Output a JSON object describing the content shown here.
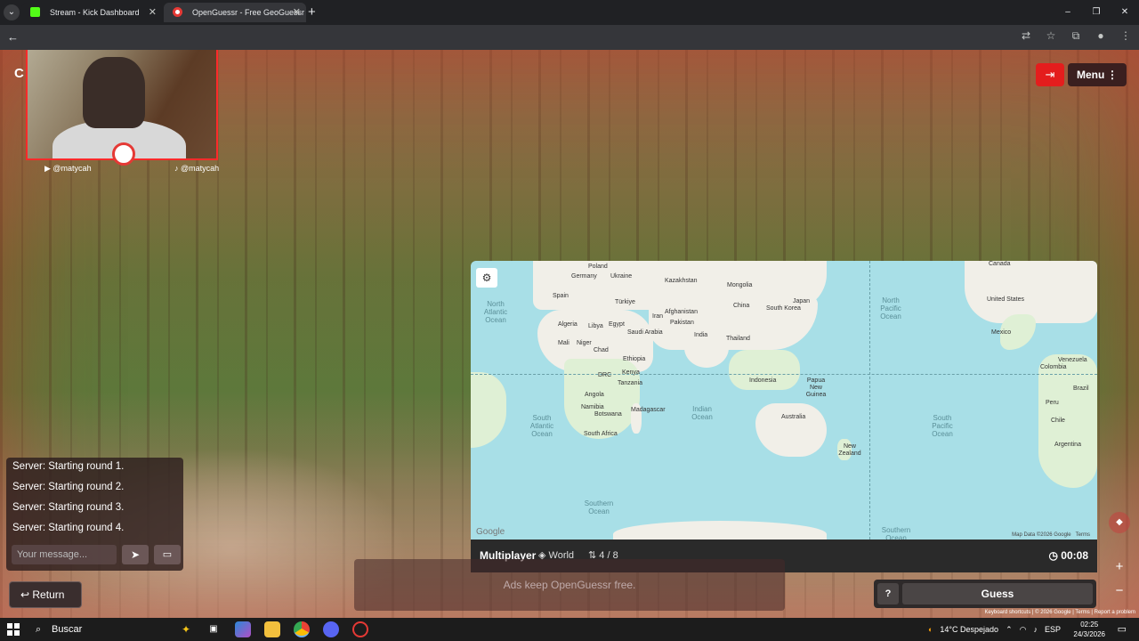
{
  "browser": {
    "tabs": [
      {
        "label": "Stream - Kick Dashboard"
      },
      {
        "label": "OpenGuessr - Free GeoGuessr"
      }
    ],
    "new_tab": "+",
    "window": {
      "minimize": "–",
      "restore": "❐",
      "close": "✕"
    }
  },
  "page": {
    "corner_letter": "C",
    "webcam": {
      "handle_left": "@matycah",
      "handle_right": "@matycah"
    },
    "menu_label": "Menu",
    "map": {
      "countries": {
        "poland": "Poland",
        "germany": "Germany",
        "ukraine": "Ukraine",
        "spain": "Spain",
        "turkiye": "Türkiye",
        "kazakhstan": "Kazakhstan",
        "mongolia": "Mongolia",
        "afghanistan": "Afghanistan",
        "iran": "Iran",
        "pakistan": "Pakistan",
        "china": "China",
        "south_korea": "South Korea",
        "japan": "Japan",
        "algeria": "Algeria",
        "libya": "Libya",
        "egypt": "Egypt",
        "saudi_arabia": "Saudi Arabia",
        "india": "India",
        "thailand": "Thailand",
        "mali": "Mali",
        "niger": "Niger",
        "chad": "Chad",
        "ethiopia": "Ethiopia",
        "kenya": "Kenya",
        "drc": "DRC",
        "tanzania": "Tanzania",
        "angola": "Angola",
        "namibia": "Namibia",
        "botswana": "Botswana",
        "south_africa": "South Africa",
        "madagascar": "Madagascar",
        "indonesia": "Indonesia",
        "papua_new_guinea": "Papua New Guinea",
        "australia": "Australia",
        "new_zealand": "New Zealand",
        "canada": "Canada",
        "united_states": "United States",
        "mexico": "Mexico",
        "venezuela": "Venezuela",
        "colombia": "Colombia",
        "brazil": "Brazil",
        "peru": "Peru",
        "chile": "Chile",
        "argentina": "Argentina"
      },
      "oceans": {
        "north_atlantic": "North Atlantic Ocean",
        "north_pacific": "North Pacific Ocean",
        "south_atlantic": "South Atlantic Ocean",
        "indian": "Indian Ocean",
        "south_pacific": "South Pacific Ocean",
        "southern_1": "Southern Ocean",
        "southern_2": "Southern Ocean"
      },
      "google": "Google",
      "map_data": "Map Data ©2026 Google",
      "terms": "Terms"
    },
    "status": {
      "mode": "Multiplayer",
      "world": "World",
      "round": "4 / 8",
      "timer": "00:08"
    },
    "chat": {
      "lines": [
        "Server: Starting round 1.",
        "Server: Starting round 2.",
        "Server: Starting round 3.",
        "Server: Starting round 4."
      ],
      "placeholder": "Your message..."
    },
    "return_label": "Return",
    "ads_text": "Ads keep OpenGuessr free.",
    "help_label": "?",
    "guess_label": "Guess",
    "zoom_in": "+",
    "zoom_out": "−",
    "footer": {
      "keyboard": "Keyboard shortcuts",
      "copyright": "© 2026 Google",
      "terms": "Terms",
      "report": "Report a problem"
    }
  },
  "taskbar": {
    "search": "Buscar",
    "weather": "14°C Despejado",
    "lang": "ESP",
    "time": "02:25",
    "date": "24/3/2026"
  }
}
